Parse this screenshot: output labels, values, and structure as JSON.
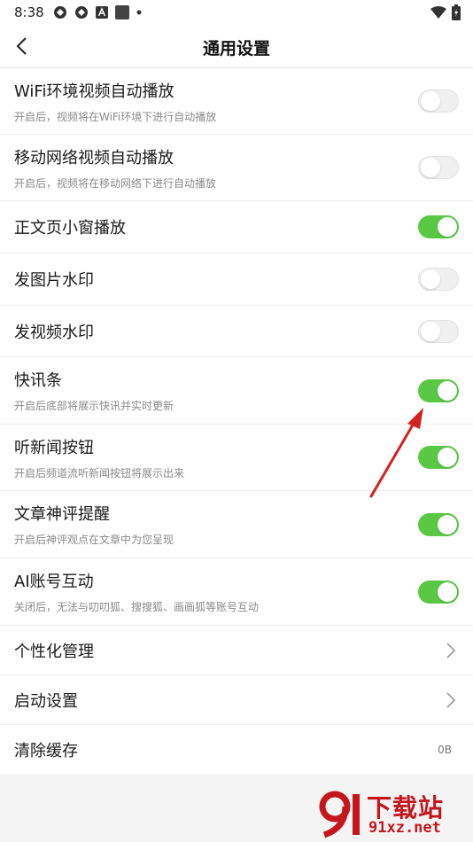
{
  "status_bar": {
    "time": "8:38",
    "icons": [
      "app-icon-1",
      "app-icon-2",
      "font-icon",
      "square-icon",
      "dot-icon"
    ],
    "right_icons": [
      "wifi-icon",
      "battery-icon"
    ]
  },
  "header": {
    "title": "通用设置",
    "back_icon": "chevron-left-icon"
  },
  "settings": [
    {
      "label": "WiFi环境视频自动播放",
      "desc": "开启后，视频将在WiFi环境下进行自动播放",
      "toggle": false
    },
    {
      "label": "移动网络视频自动播放",
      "desc": "开启后，视频将在移动网络下进行自动播放",
      "toggle": false
    },
    {
      "label": "正文页小窗播放",
      "toggle": true
    },
    {
      "label": "发图片水印",
      "toggle": false
    },
    {
      "label": "发视频水印",
      "toggle": false
    },
    {
      "label": "快讯条",
      "desc": "开启后底部将展示快讯并实时更新",
      "toggle": true
    },
    {
      "label": "听新闻按钮",
      "desc": "开启后频道流听新闻按钮将展示出来",
      "toggle": true
    },
    {
      "label": "文章神评提醒",
      "desc": "开启后神评观点在文章中为您呈现",
      "toggle": true
    },
    {
      "label": "AI账号互动",
      "desc": "关闭后，无法与叨叨狐、搜搜狐、画画狐等账号互动",
      "toggle": true
    },
    {
      "label": "个性化管理",
      "action": "chevron-right-icon"
    },
    {
      "label": "启动设置",
      "action": "chevron-right-icon"
    },
    {
      "label": "清除缓存",
      "value": "0B"
    }
  ],
  "colors": {
    "toggle_on": "#5ac845",
    "toggle_off": "#f0f0f0",
    "annotation_arrow": "#d42020",
    "watermark": "#c4161c"
  },
  "watermark": {
    "text": "下载站",
    "url": "91xz.net"
  }
}
